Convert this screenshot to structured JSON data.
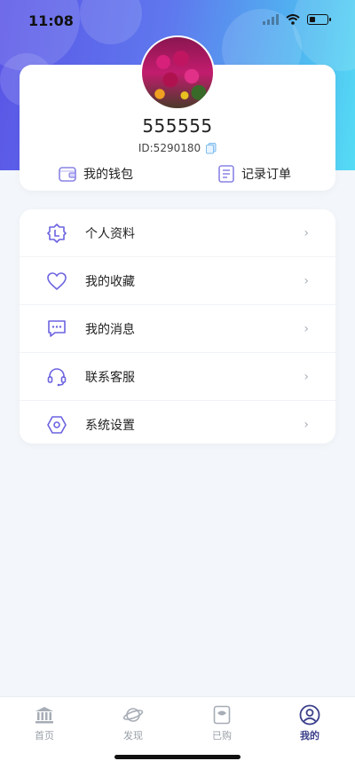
{
  "status_bar": {
    "time": "11:08"
  },
  "profile": {
    "username": "555555",
    "user_id": "ID:5290180"
  },
  "quick_actions": [
    {
      "label": "我的钱包",
      "icon": "wallet-icon"
    },
    {
      "label": "记录订单",
      "icon": "order-record-icon"
    }
  ],
  "menu": {
    "items": [
      {
        "label": "个人资料",
        "icon": "profile-badge-icon"
      },
      {
        "label": "我的收藏",
        "icon": "heart-icon"
      },
      {
        "label": "我的消息",
        "icon": "message-icon"
      },
      {
        "label": "联系客服",
        "icon": "headset-icon"
      },
      {
        "label": "系统设置",
        "icon": "settings-icon"
      }
    ],
    "chevron": "›"
  },
  "tabbar": {
    "tabs": [
      {
        "label": "首页",
        "icon": "bank-icon",
        "active": false
      },
      {
        "label": "发现",
        "icon": "planet-icon",
        "active": false
      },
      {
        "label": "已购",
        "icon": "purchased-icon",
        "active": false
      },
      {
        "label": "我的",
        "icon": "user-circle-icon",
        "active": true
      }
    ]
  },
  "colors": {
    "accent": "#6c63e0",
    "hero_start": "#5a55e6",
    "hero_end": "#55dcf5",
    "active_tab": "#3b3f8a",
    "inactive_tab": "#9aa0a8"
  }
}
